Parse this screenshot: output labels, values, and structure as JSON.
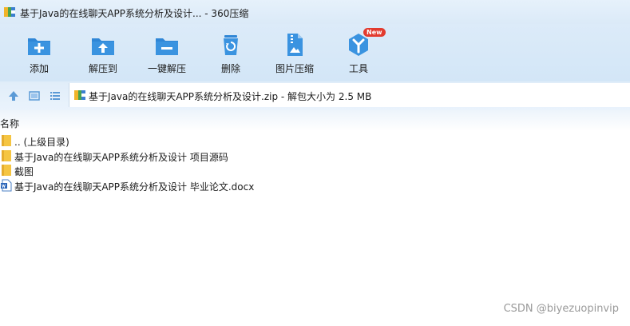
{
  "window": {
    "title": "基于Java的在线聊天APP系统分析及设计... - 360压缩"
  },
  "toolbar": {
    "tools": [
      {
        "label": "添加",
        "icon": "add-icon"
      },
      {
        "label": "解压到",
        "icon": "extract-to-icon"
      },
      {
        "label": "一键解压",
        "icon": "one-click-extract-icon"
      },
      {
        "label": "删除",
        "icon": "delete-icon"
      },
      {
        "label": "图片压缩",
        "icon": "image-compress-icon"
      },
      {
        "label": "工具",
        "icon": "tools-icon",
        "badge": "New"
      }
    ]
  },
  "nav": {
    "path": "基于Java的在线聊天APP系统分析及设计.zip - 解包大小为 2.5 MB"
  },
  "list": {
    "column_name": "名称",
    "items": [
      {
        "name": ".. (上级目录)",
        "type": "folder"
      },
      {
        "name": "基于Java的在线聊天APP系统分析及设计 项目源码",
        "type": "folder"
      },
      {
        "name": "截图",
        "type": "folder"
      },
      {
        "name": "基于Java的在线聊天APP系统分析及设计 毕业论文.docx",
        "type": "docx"
      }
    ]
  },
  "watermark": "CSDN @biyezuopinvip",
  "colors": {
    "accent": "#2f86d6",
    "folder": "#f5c542",
    "badge": "#e23b2f"
  }
}
